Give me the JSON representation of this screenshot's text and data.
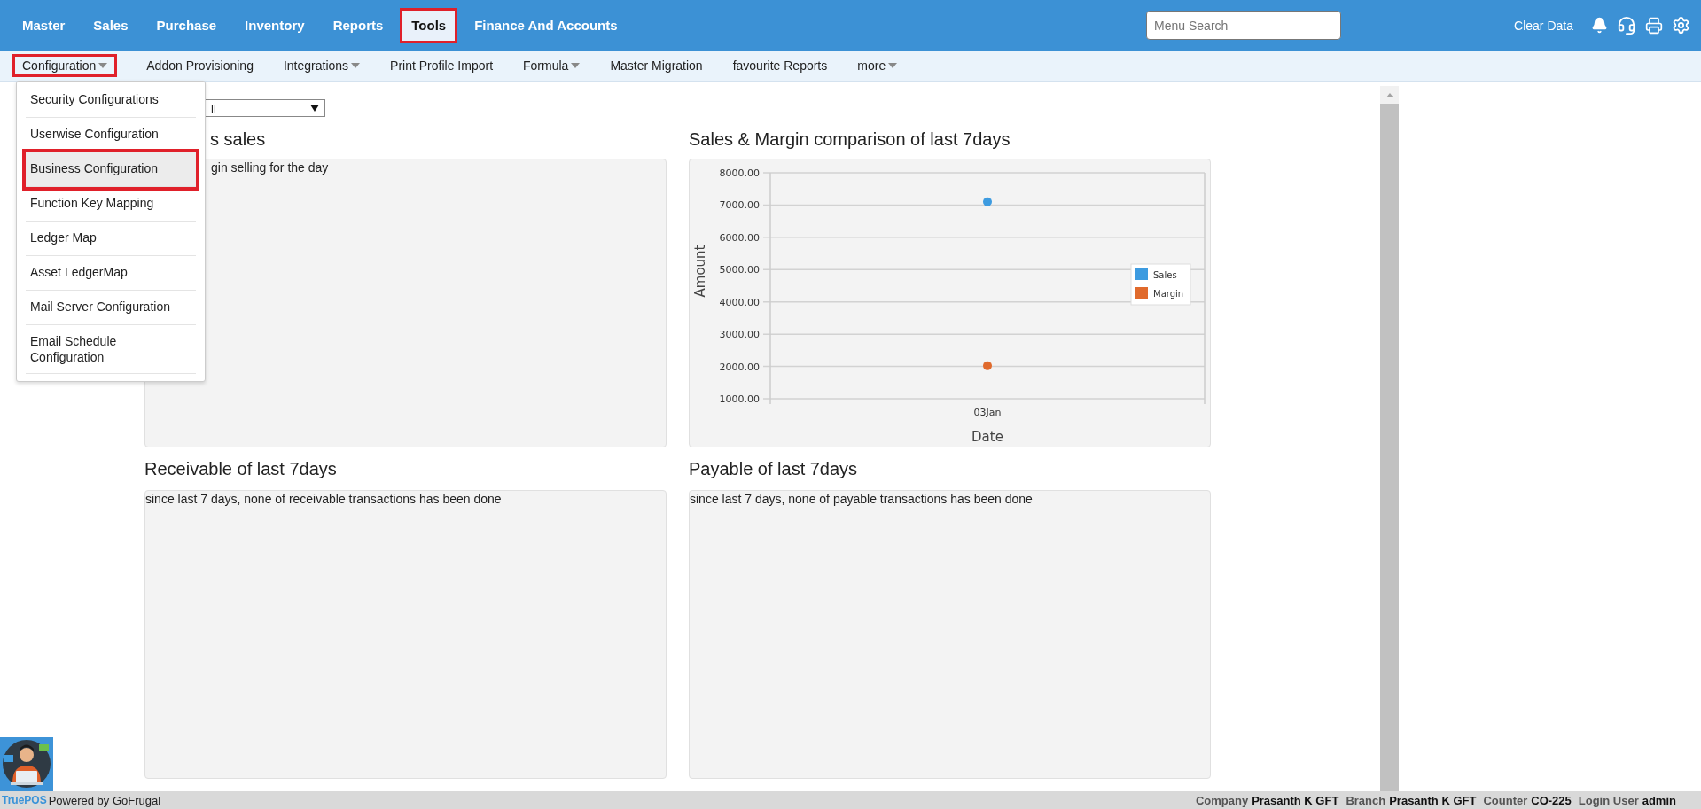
{
  "top_nav": [
    {
      "label": "Master",
      "selected": false
    },
    {
      "label": "Sales",
      "selected": false
    },
    {
      "label": "Purchase",
      "selected": false
    },
    {
      "label": "Inventory",
      "selected": false
    },
    {
      "label": "Reports",
      "selected": false
    },
    {
      "label": "Tools",
      "selected": true
    },
    {
      "label": "Finance And Accounts",
      "selected": false
    }
  ],
  "menu_search": {
    "placeholder": "Menu Search"
  },
  "clear_data": "Clear Data",
  "sub_nav": [
    {
      "label": "Configuration",
      "kind": "dropdown",
      "selected": true
    },
    {
      "label": "Addon Provisioning",
      "kind": "link",
      "selected": false
    },
    {
      "label": "Integrations",
      "kind": "dropdown",
      "selected": false
    },
    {
      "label": "Print Profile Import",
      "kind": "link",
      "selected": false
    },
    {
      "label": "Formula",
      "kind": "dropdown",
      "selected": false
    },
    {
      "label": "Master Migration",
      "kind": "link",
      "selected": false
    },
    {
      "label": "favourite Reports",
      "kind": "link",
      "selected": false
    },
    {
      "label": "more",
      "kind": "dropdown",
      "selected": false
    }
  ],
  "configuration_menu": [
    {
      "label": "Security Configurations",
      "selected": false
    },
    {
      "label": "Userwise Configuration",
      "selected": false
    },
    {
      "label": "Business Configuration",
      "selected": true
    },
    {
      "label": "Function Key Mapping",
      "selected": false
    },
    {
      "label": "Ledger Map",
      "selected": false
    },
    {
      "label": "Asset LedgerMap",
      "selected": false
    },
    {
      "label": "Mail Server Configuration",
      "selected": false
    },
    {
      "label": "Email Schedule Configuration",
      "selected": false
    }
  ],
  "filter_select": {
    "value": "ll"
  },
  "panels": [
    {
      "title": "s sales",
      "message": "gin selling for the day"
    },
    {
      "title": "Sales & Margin comparison of last 7days",
      "chart_data": {
        "type": "scatter",
        "grid": true,
        "legend": true,
        "xlabel": "Date",
        "ylabel": "Amount",
        "categories": [
          "03Jan"
        ],
        "ylim": [
          1000,
          8000
        ],
        "yticks": [
          {
            "value": 1000,
            "label": "1000.00"
          },
          {
            "value": 2000,
            "label": "2000.00"
          },
          {
            "value": 3000,
            "label": "3000.00"
          },
          {
            "value": 4000,
            "label": "4000.00"
          },
          {
            "value": 5000,
            "label": "5000.00"
          },
          {
            "value": 6000,
            "label": "6000.00"
          },
          {
            "value": 7000,
            "label": "7000.00"
          },
          {
            "value": 8000,
            "label": "8000.00"
          }
        ],
        "series": [
          {
            "name": "Sales",
            "color": "#3d9be0",
            "values": [
              7100
            ]
          },
          {
            "name": "Margin",
            "color": "#e06a2c",
            "values": [
              2020
            ]
          }
        ]
      }
    },
    {
      "title": "Receivable of last 7days",
      "message": "since last 7 days, none of receivable transactions has been done"
    },
    {
      "title": "Payable of last 7days",
      "message": "since last 7 days, none of payable transactions has been done"
    }
  ],
  "brand": "TruePOS",
  "powered_by": "Powered by GoFrugal",
  "status": [
    {
      "label": "Company",
      "value": "Prasanth K GFT"
    },
    {
      "label": "Branch",
      "value": "Prasanth K GFT"
    },
    {
      "label": "Counter",
      "value": "CO-225"
    },
    {
      "label": "Login User",
      "value": "admin"
    }
  ]
}
